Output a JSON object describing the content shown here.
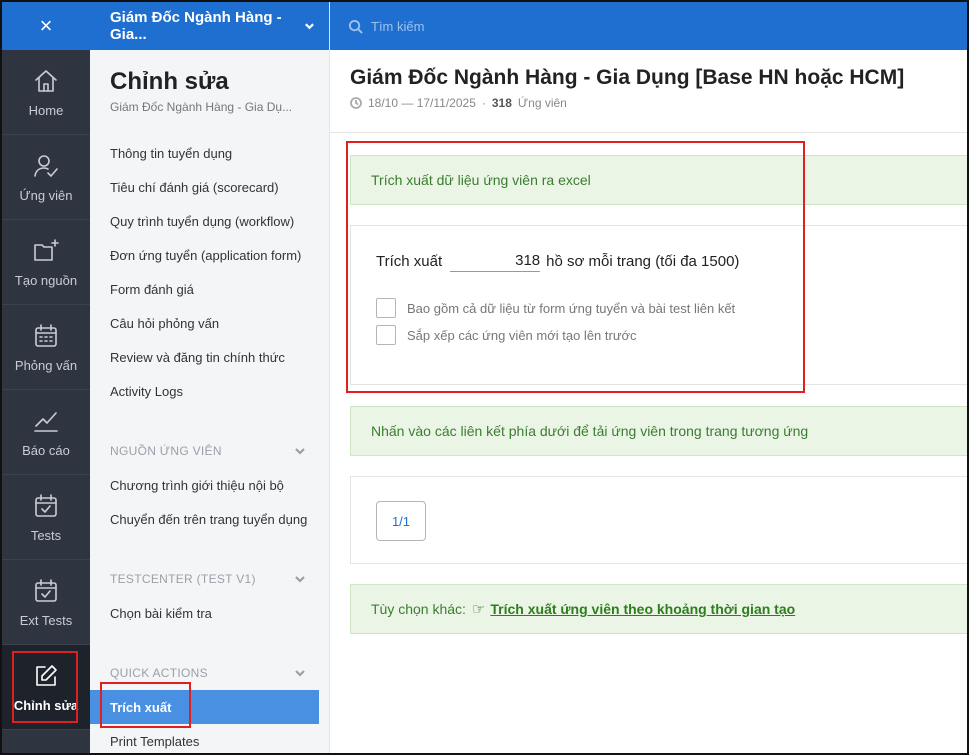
{
  "rail": {
    "close_icon": "×",
    "items": [
      {
        "label": "Home",
        "icon": "home-icon"
      },
      {
        "label": "Ứng viên",
        "icon": "user-check-icon"
      },
      {
        "label": "Tạo nguồn",
        "icon": "folder-plus-icon"
      },
      {
        "label": "Phỏng vấn",
        "icon": "calendar-icon"
      },
      {
        "label": "Báo cáo",
        "icon": "chart-line-icon"
      },
      {
        "label": "Tests",
        "icon": "test-icon"
      },
      {
        "label": "Ext Tests",
        "icon": "ext-test-icon"
      },
      {
        "label": "Chỉnh sửa",
        "icon": "edit-icon"
      }
    ]
  },
  "panel": {
    "job_selector": "Giám Đốc Ngành Hàng - Gia...",
    "title": "Chỉnh sửa",
    "subtitle": "Giám Đốc Ngành Hàng - Gia Dụ...",
    "menu": [
      "Thông tin tuyển dụng",
      "Tiêu chí đánh giá (scorecard)",
      "Quy trình tuyển dụng (workflow)",
      "Đơn ứng tuyển (application form)",
      "Form đánh giá",
      "Câu hỏi phỏng vấn",
      "Review và đăng tin chính thức",
      "Activity Logs"
    ],
    "section_sources": "NGUỒN ỨNG VIÊN",
    "sources_menu": [
      "Chương trình giới thiệu nội bộ",
      "Chuyển đến trên trang tuyển dụng"
    ],
    "section_testcenter": "TESTCENTER (TEST V1)",
    "testcenter_menu": [
      "Chọn bài kiểm tra"
    ],
    "section_quick": "QUICK ACTIONS",
    "quick_menu": [
      "Trích xuất",
      "Print Templates"
    ]
  },
  "search": {
    "placeholder": "Tìm kiếm"
  },
  "main": {
    "title": "Giám Đốc Ngành Hàng - Gia Dụng [Base HN hoặc HCM]",
    "date_range": "18/10 — 17/11/2025",
    "separator": "·",
    "candidate_count": "318",
    "candidate_label": "Ứng viên",
    "export_header": "Trích xuất dữ liệu ứng viên ra excel",
    "export_label": "Trích xuất",
    "export_value": "318",
    "export_suffix": "hồ sơ mỗi trang (tối đa 1500)",
    "checkbox_form": "Bao gồm cả dữ liệu từ form ứng tuyển và bài test liên kết",
    "checkbox_sort": "Sắp xếp các ứng viên mới tạo lên trước",
    "download_hint": "Nhấn vào các liên kết phía dưới để tải ứng viên trong trang tương ứng",
    "page_link": "1/1",
    "other_label": "Tùy chọn khác:",
    "other_link": "Trích xuất ứng viên theo khoảng thời gian tạo"
  }
}
